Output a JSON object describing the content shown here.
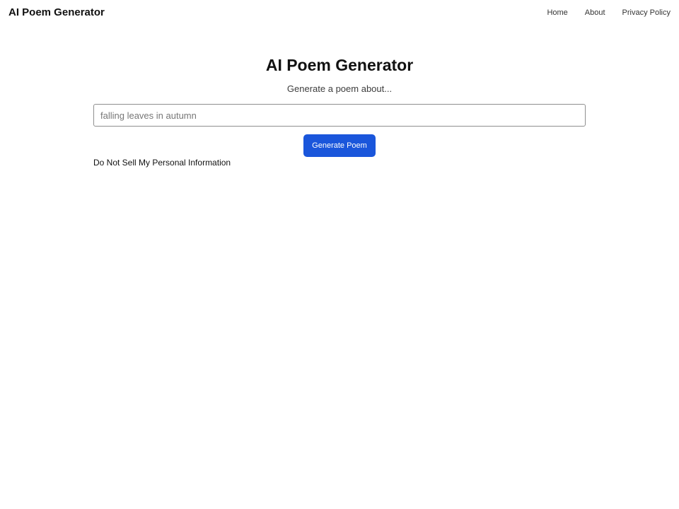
{
  "header": {
    "brand": "AI Poem Generator",
    "nav": [
      {
        "label": "Home"
      },
      {
        "label": "About"
      },
      {
        "label": "Privacy Policy"
      }
    ]
  },
  "main": {
    "title": "AI Poem Generator",
    "prompt_label": "Generate a poem about...",
    "input": {
      "placeholder": "falling leaves in autumn",
      "value": ""
    },
    "button_label": "Generate Poem",
    "privacy_link": "Do Not Sell My Personal Information"
  },
  "colors": {
    "accent": "#1a56db",
    "text": "#111111",
    "input_border": "#8f8f8f"
  }
}
